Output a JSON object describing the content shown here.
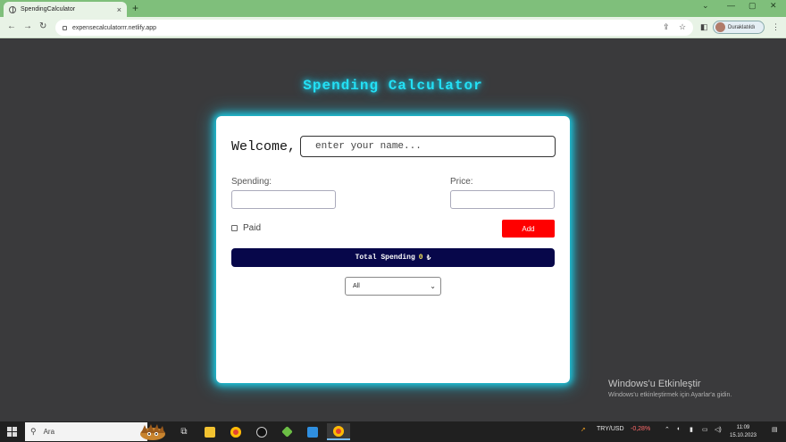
{
  "browser": {
    "tab_title": "SpendingCalculator",
    "tab_close": "×",
    "new_tab": "+",
    "url": "expensecalculatorrr.netlify.app",
    "profile_name": "Duraklatıldı"
  },
  "app": {
    "title": "Spending Calculator",
    "welcome": "Welcome,",
    "name_placeholder": "enter your name...",
    "spending_label": "Spending:",
    "price_label": "Price:",
    "paid_label": "Paid",
    "add_label": "Add",
    "total_label": "Total Spending",
    "total_amount": "0",
    "currency": "₺",
    "filter_selected": "All"
  },
  "watermark": {
    "line1": "Windows'u Etkinleştir",
    "line2": "Windows'u etkinleştirmek için Ayarlar'a gidin."
  },
  "taskbar": {
    "search_label": "Ara",
    "currency_pair": "TRY/USD",
    "currency_change": "-0,28%",
    "time": "11:09",
    "date": "15.10.2023"
  },
  "colors": {
    "accent_cyan": "#23e0f5",
    "add_button": "#ff0000",
    "total_bar": "#07074a",
    "browser_frame": "#7fbf7b"
  }
}
